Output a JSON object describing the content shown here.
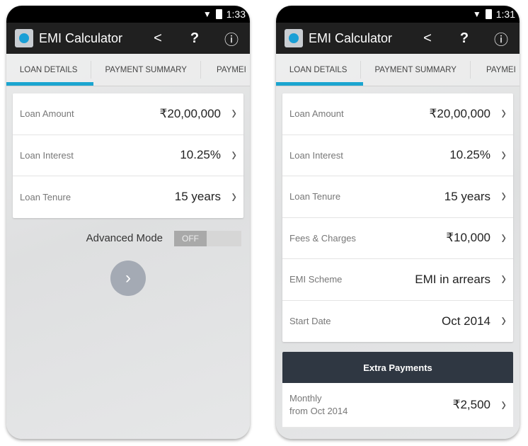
{
  "screens": [
    {
      "time": "1:33",
      "app_title": "EMI Calculator",
      "tabs": [
        "LOAN DETAILS",
        "PAYMENT SUMMARY",
        "PAYMEI"
      ],
      "rows": [
        {
          "label": "Loan Amount",
          "value": "₹20,00,000"
        },
        {
          "label": "Loan Interest",
          "value": "10.25%"
        },
        {
          "label": "Loan Tenure",
          "value": "15 years"
        }
      ],
      "advanced_mode": {
        "label": "Advanced Mode",
        "state": "OFF"
      }
    },
    {
      "time": "1:31",
      "app_title": "EMI Calculator",
      "tabs": [
        "LOAN DETAILS",
        "PAYMENT SUMMARY",
        "PAYMEI"
      ],
      "rows": [
        {
          "label": "Loan Amount",
          "value": "₹20,00,000"
        },
        {
          "label": "Loan Interest",
          "value": "10.25%"
        },
        {
          "label": "Loan Tenure",
          "value": "15 years"
        },
        {
          "label": "Fees & Charges",
          "value": "₹10,000"
        },
        {
          "label": "EMI Scheme",
          "value": "EMI in arrears"
        },
        {
          "label": "Start Date",
          "value": "Oct 2014"
        }
      ],
      "extra_payments": {
        "title": "Extra Payments",
        "items": [
          {
            "label_line1": "Monthly",
            "label_line2": "from Oct 2014",
            "value": "₹2,500"
          }
        ]
      }
    }
  ],
  "icons": {
    "share": "share-icon",
    "help": "help-icon",
    "info": "info-icon",
    "chevron": "chevron-right-icon"
  },
  "colors": {
    "accent": "#1ba5d0",
    "toolbar": "#202020",
    "extra_header": "#2f3742"
  }
}
